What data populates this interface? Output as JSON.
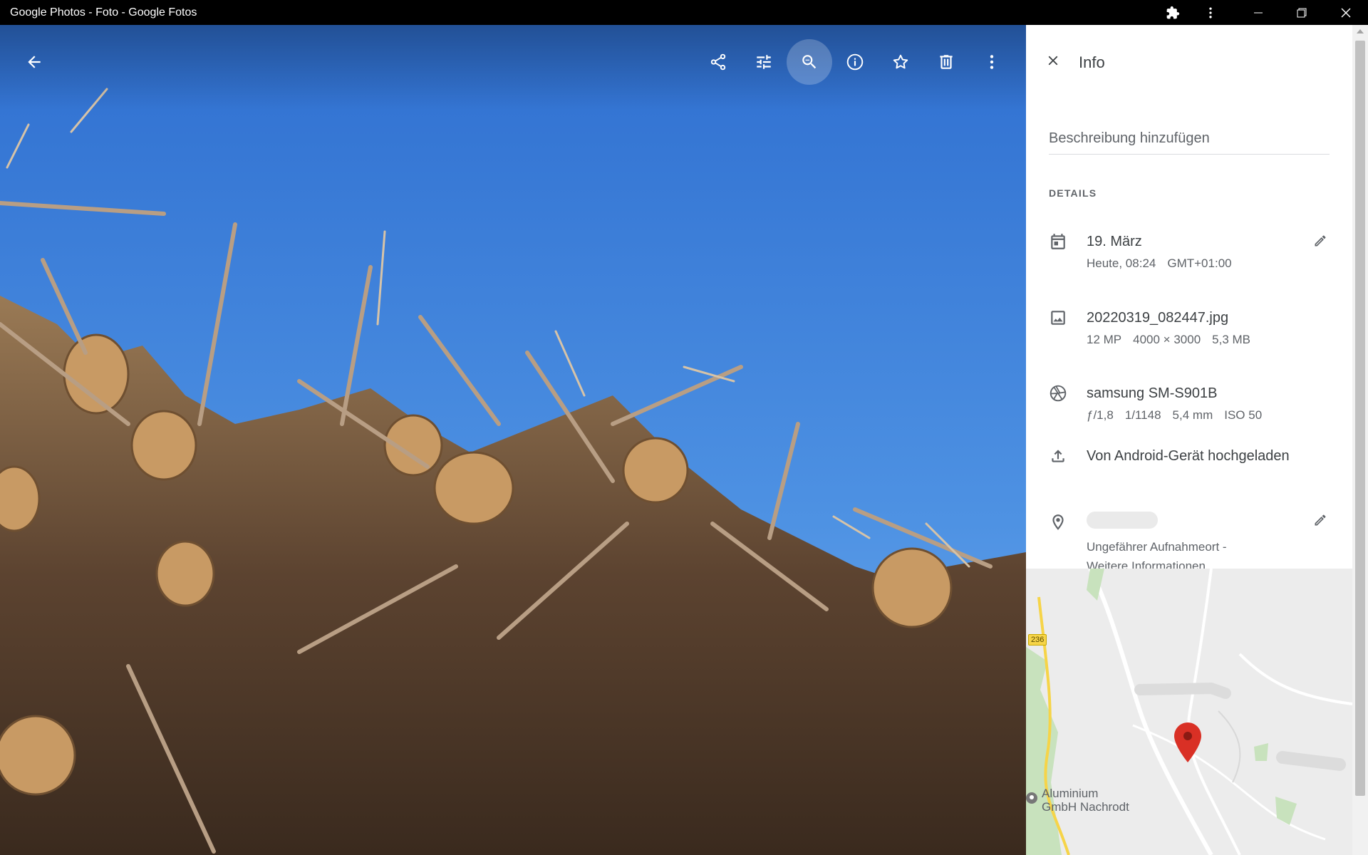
{
  "window": {
    "title": "Google Photos - Foto - Google Fotos"
  },
  "viewer": {
    "toolbar": {
      "back": "arrow-left-icon",
      "share": "share-icon",
      "edit": "tune-icon",
      "zoom": "zoom-out-icon",
      "info": "info-icon",
      "favorite": "star-icon",
      "delete": "trash-icon",
      "more": "more-vert-icon"
    }
  },
  "info_panel": {
    "title": "Info",
    "description_placeholder": "Beschreibung hinzufügen",
    "details_label": "DETAILS",
    "date": {
      "primary": "19. März",
      "time": "Heute, 08:24",
      "timezone": "GMT+01:00"
    },
    "file": {
      "name": "20220319_082447.jpg",
      "megapixels": "12 MP",
      "resolution": "4000 × 3000",
      "size": "5,3 MB"
    },
    "camera": {
      "model": "samsung SM-S901B",
      "aperture": "ƒ/1,8",
      "shutter": "1/1148",
      "focal_length": "5,4 mm",
      "iso": "ISO 50"
    },
    "upload": {
      "text": "Von Android-Gerät hochgeladen"
    },
    "location": {
      "approx_text": "Ungefährer Aufnahmeort -",
      "more_link": "Weitere Informationen"
    },
    "map": {
      "road_label": "236",
      "place_label_line1": "Aluminium",
      "place_label_line2": "GmbH Nachrodt"
    }
  },
  "colors": {
    "sky": "#3b7fd6",
    "panel_bg": "#ffffff",
    "map_marker": "#d93025"
  }
}
